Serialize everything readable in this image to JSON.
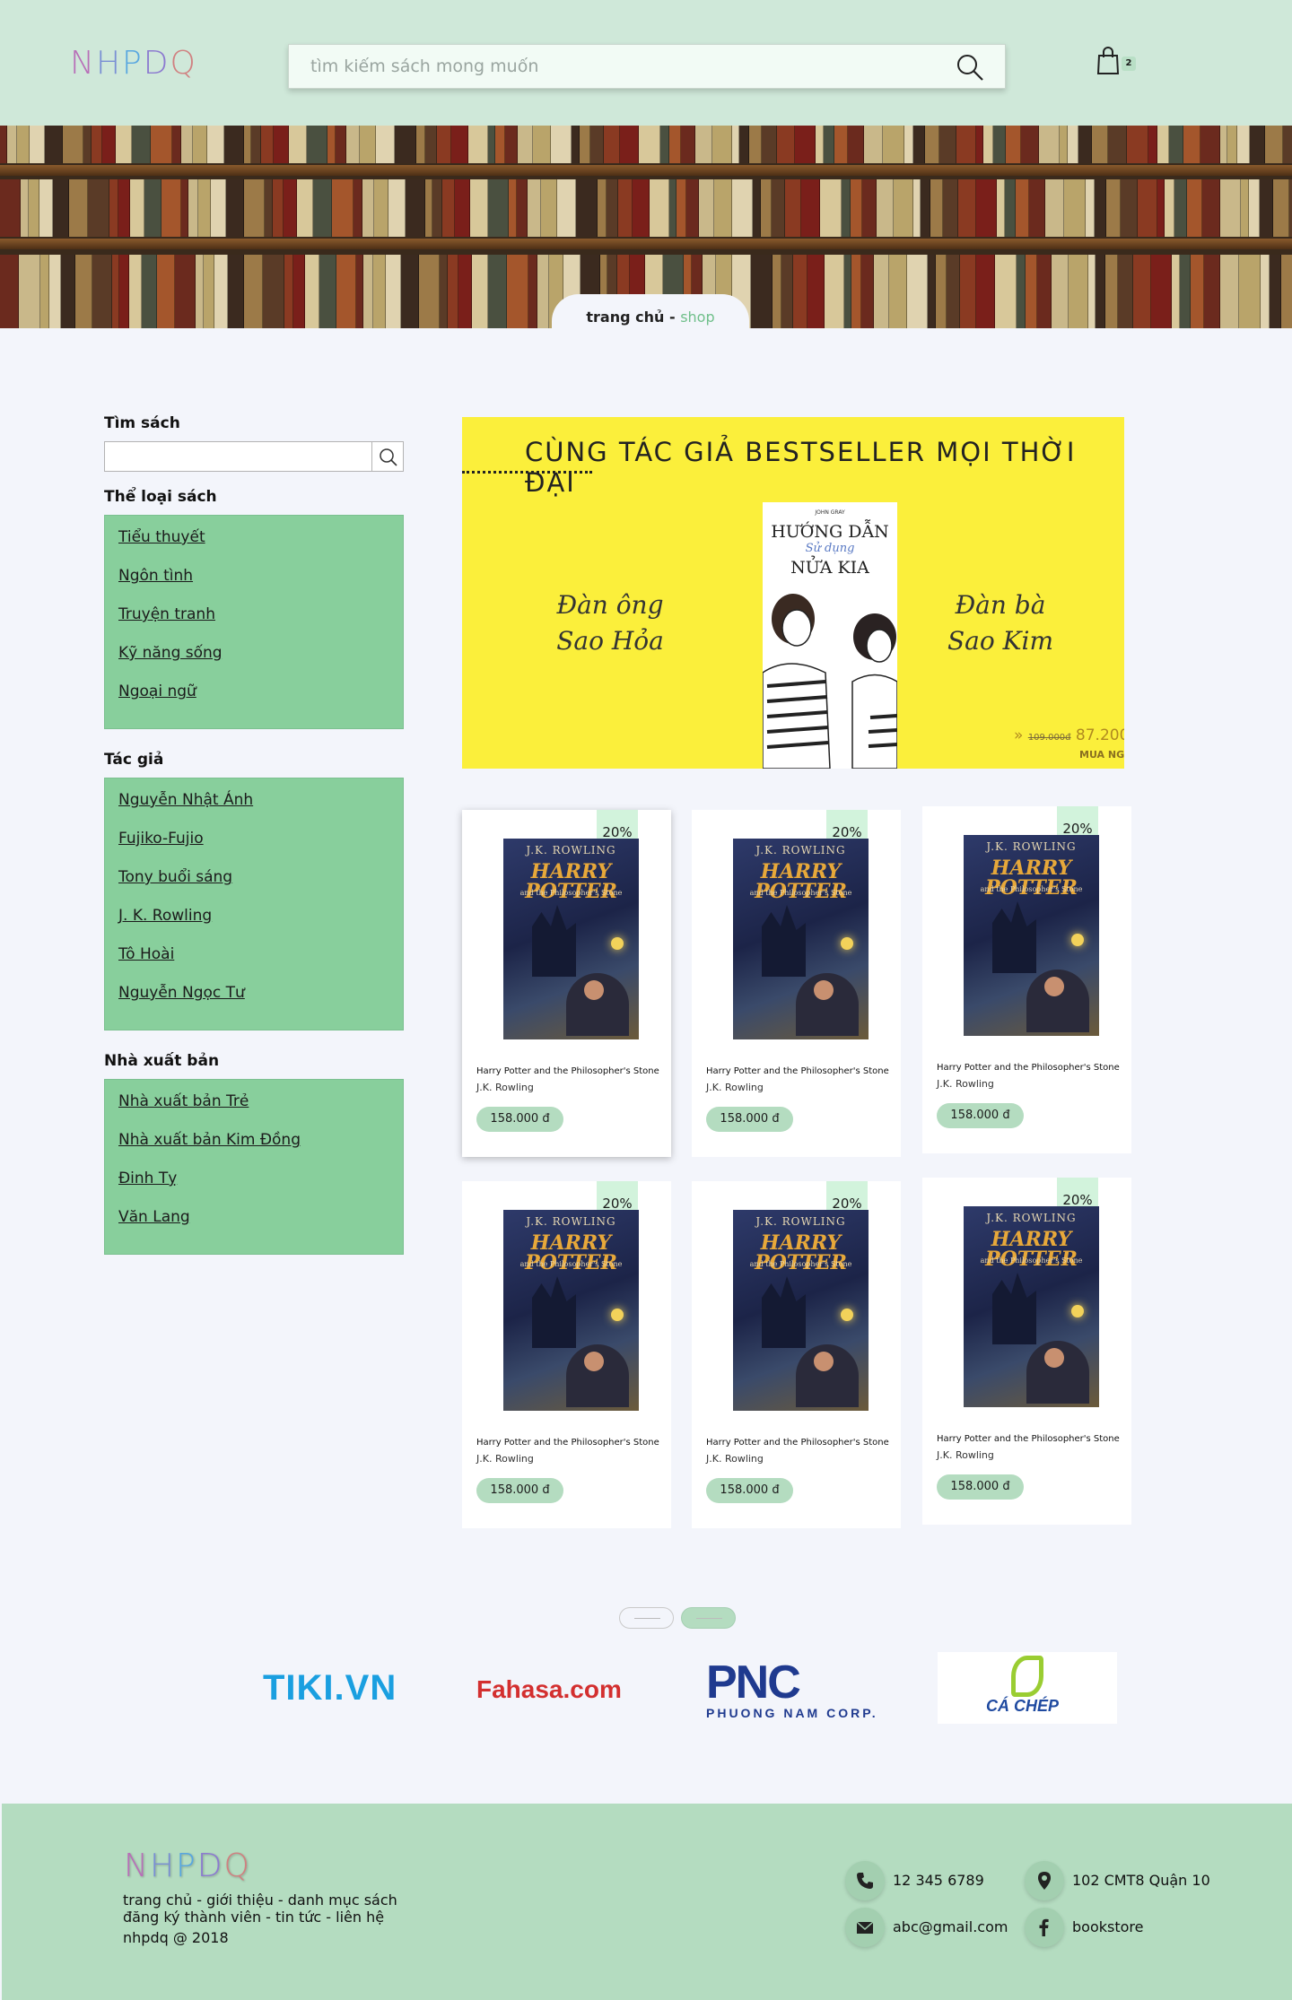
{
  "header": {
    "logo": [
      "N",
      "H",
      "P",
      "D",
      "Q"
    ],
    "search_placeholder": "tìm kiếm sách mong muốn",
    "cart_count": "2"
  },
  "breadcrumb": {
    "home": "trang chủ - ",
    "current": "shop"
  },
  "sidebar": {
    "search_title": "Tìm sách",
    "categories_title": "Thể loại sách",
    "categories": [
      "Tiểu thuyết",
      "Ngôn tình",
      "Truyện tranh",
      "Kỹ năng sống",
      "Ngoại ngữ"
    ],
    "authors_title": "Tác giả",
    "authors": [
      "Nguyễn Nhật Ánh",
      "Fujiko-Fujio",
      "Tony buổi sáng",
      "J. K. Rowling",
      "Tô Hoài",
      "Nguyễn Ngọc Tư"
    ],
    "publishers_title": "Nhà xuất bản",
    "publishers": [
      "Nhà xuất bản Trẻ",
      "Nhà xuất bản Kim Đồng",
      "Đinh Tỵ",
      "Văn Lang"
    ]
  },
  "banner": {
    "title": "CÙNG TÁC GIẢ BESTSELLER MỌI THỜI ĐẠI",
    "left_text": "Đàn ông Sao Hỏa",
    "right_text": "Đàn bà Sao Kim",
    "book_author": "JOHN GRAY",
    "book_title_1": "HƯỚNG DẪN",
    "book_title_2": "Sử dụng",
    "book_title_3": "NỬA KIA",
    "old_price": "109.000đ",
    "new_price": "87.200",
    "buy_label": "MUA NGAY"
  },
  "products": [
    {
      "discount": "20%",
      "title": "Harry Potter and the Philosopher's Stone",
      "author": "J.K. Rowling",
      "price": "158.000 đ",
      "cover_author": "J.K. ROWLING",
      "cover_title": "HARRY POTTER",
      "cover_subtitle": "and the Philosopher's Stone"
    },
    {
      "discount": "20%",
      "title": "Harry Potter and the Philosopher's Stone",
      "author": "J.K. Rowling",
      "price": "158.000 đ",
      "cover_author": "J.K. ROWLING",
      "cover_title": "HARRY POTTER",
      "cover_subtitle": "and the Philosopher's Stone"
    },
    {
      "discount": "20%",
      "title": "Harry Potter and the Philosopher's Stone",
      "author": "J.K. Rowling",
      "price": "158.000 đ",
      "cover_author": "J.K. ROWLING",
      "cover_title": "HARRY POTTER",
      "cover_subtitle": "and the Philosopher's Stone"
    },
    {
      "discount": "20%",
      "title": "Harry Potter and the Philosopher's Stone",
      "author": "J.K. Rowling",
      "price": "158.000 đ",
      "cover_author": "J.K. ROWLING",
      "cover_title": "HARRY POTTER",
      "cover_subtitle": "and the Philosopher's Stone"
    },
    {
      "discount": "20%",
      "title": "Harry Potter and the Philosopher's Stone",
      "author": "J.K. Rowling",
      "price": "158.000 đ",
      "cover_author": "J.K. ROWLING",
      "cover_title": "HARRY POTTER",
      "cover_subtitle": "and the Philosopher's Stone"
    },
    {
      "discount": "20%",
      "title": "Harry Potter and the Philosopher's Stone",
      "author": "J.K. Rowling",
      "price": "158.000 đ",
      "cover_author": "J.K. ROWLING",
      "cover_title": "HARRY POTTER",
      "cover_subtitle": "and the Philosopher's Stone"
    }
  ],
  "partners": {
    "tiki": "TIKI.VN",
    "fahasa": "Fahasa.com",
    "pnc_big": "PNC",
    "pnc_small": "PHUONG NAM CORP.",
    "cachep": "CÁ CHÉP"
  },
  "footer": {
    "logo": [
      "N",
      "H",
      "P",
      "D",
      "Q"
    ],
    "nav_line1": "trang chủ - giới thiệu - danh mục sách",
    "nav_line2": "đăng ký thành viên - tin tức -  liên hệ",
    "copyright": "nhpdq @ 2018",
    "phone": "12 345 6789",
    "address": "102 CMT8 Quận 10",
    "email": "abc@gmail.com",
    "facebook": "bookstore"
  },
  "colors": {
    "header_bg": "#cfe8d9",
    "sidebar_box": "#88cf9c",
    "price_pill": "#b4dcc0",
    "discount_badge": "#d2f3dc",
    "banner_bg": "#fbef3b",
    "footer_bg": "#b4dcc0"
  },
  "icons": {
    "search": "search-icon",
    "cart": "shopping-bag-icon",
    "phone": "phone-icon",
    "address": "map-pin-icon",
    "email": "mail-icon",
    "facebook": "facebook-icon"
  }
}
